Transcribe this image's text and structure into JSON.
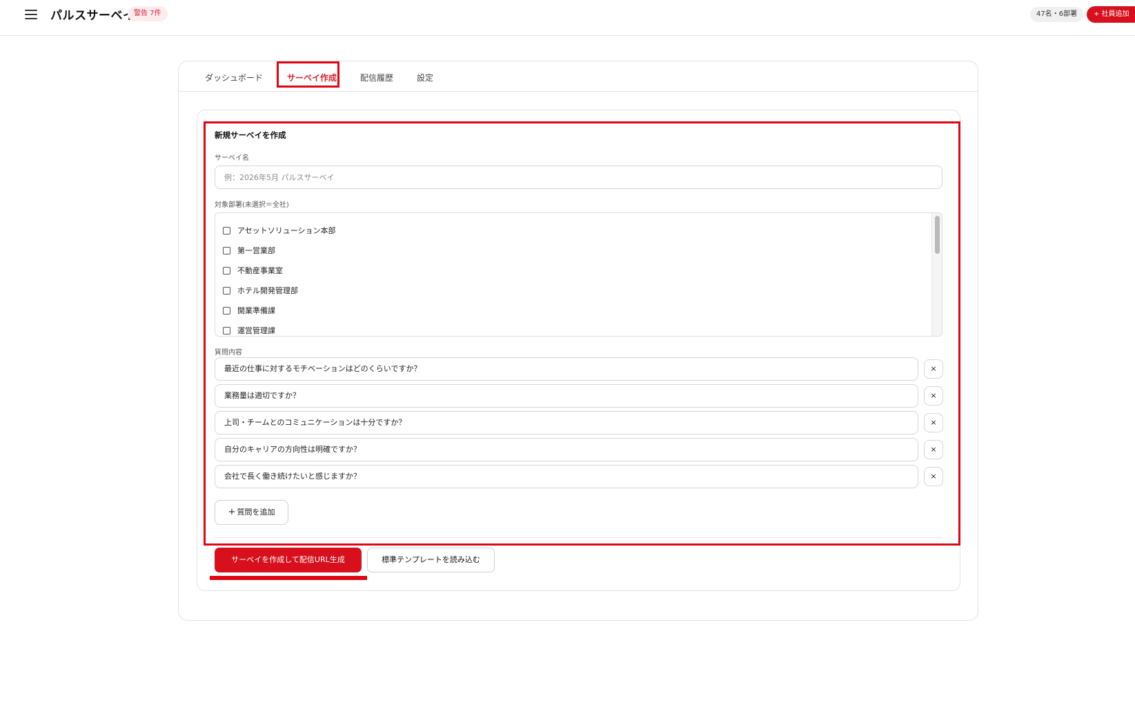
{
  "header": {
    "title": "パルスサーベイ",
    "warning_badge": "警告 7件",
    "stats": "47名・6部署",
    "add_employee_label": "+ 社員追加"
  },
  "tabs": [
    {
      "label": "ダッシュボード",
      "active": false
    },
    {
      "label": "サーベイ作成",
      "active": true
    },
    {
      "label": "配信履歴",
      "active": false
    },
    {
      "label": "設定",
      "active": false
    }
  ],
  "form": {
    "title": "新規サーベイを作成",
    "name_label": "サーベイ名",
    "name_placeholder": "例：2026年5月 パルスサーベイ",
    "name_value": "",
    "dept_label": "対象部署(未選択＝全社)",
    "departments": [
      {
        "label": "アセットソリューション本部",
        "checked": false
      },
      {
        "label": "第一営業部",
        "checked": false
      },
      {
        "label": "不動産事業室",
        "checked": false
      },
      {
        "label": "ホテル開発管理部",
        "checked": false
      },
      {
        "label": "開業準備課",
        "checked": false
      },
      {
        "label": "運営管理課",
        "checked": false
      }
    ],
    "questions_label": "質問内容",
    "questions": [
      "最近の仕事に対するモチベーションはどのくらいですか？",
      "業務量は適切ですか？",
      "上司・チームとのコミュニケーションは十分ですか？",
      "自分のキャリアの方向性は明確ですか？",
      "会社で長く働き続けたいと感じますか？"
    ],
    "remove_label": "×",
    "add_question_label": "質問を追加",
    "add_question_icon": "+"
  },
  "actions": {
    "create_label": "サーベイを作成して配信URL生成",
    "template_label": "標準テンプレートを読み込む"
  },
  "colors": {
    "accent": "#d8101d",
    "highlight": "#e00512"
  }
}
